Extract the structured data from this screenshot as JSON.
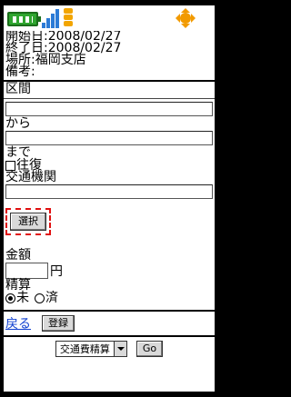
{
  "status": {
    "battery_icon": "battery-icon",
    "signal_icon": "signal-icon",
    "mail_icon": "mail-stack-icon",
    "nav_icon": "nav-dpad-icon",
    "accent": "#f29a00"
  },
  "info": {
    "start": "開始日:2008/02/27",
    "end": "終了日:2008/02/27",
    "place": "場所:福岡支店",
    "note": "備考:"
  },
  "form": {
    "section_label": "区間",
    "from_label": "から",
    "to_label": "まで",
    "roundtrip_label": "往復",
    "transport_label": "交通機関",
    "select_button": "選択",
    "amount_label": "金額",
    "amount_unit": "円",
    "settle_label": "精算",
    "settle_unpaid": "未",
    "settle_paid": "済",
    "settle_selected": "未"
  },
  "actions": {
    "back_link": "戻る",
    "register_button": "登録"
  },
  "footer": {
    "menu_value": "交通費精算",
    "go_button": "Go"
  }
}
